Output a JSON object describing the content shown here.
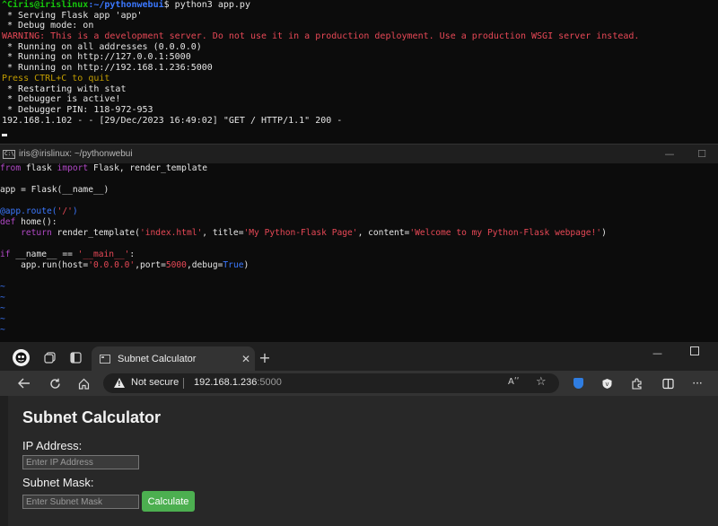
{
  "terminal_top": {
    "prompt_user": "^Ciris@irislinux",
    "prompt_path": ":~/pythonwebui",
    "prompt_symbol": "$",
    "prompt_command": " python3 app.py",
    "lines": [
      {
        "text": " * Serving Flask app 'app'",
        "color": "default"
      },
      {
        "text": " * Debug mode: on",
        "color": "default"
      },
      {
        "text": "WARNING: This is a development server. Do not use it in a production deployment. Use a production WSGI server instead.",
        "color": "red"
      },
      {
        "text": " * Running on all addresses (0.0.0.0)",
        "color": "default"
      },
      {
        "text": " * Running on http://127.0.0.1:5000",
        "color": "default"
      },
      {
        "text": " * Running on http://192.168.1.236:5000",
        "color": "default"
      },
      {
        "text": "Press CTRL+C to quit",
        "color": "yellow"
      },
      {
        "text": " * Restarting with stat",
        "color": "default"
      },
      {
        "text": " * Debugger is active!",
        "color": "default"
      },
      {
        "text": " * Debugger PIN: 118-972-953",
        "color": "default"
      },
      {
        "text": "192.168.1.102 - - [29/Dec/2023 16:49:02] \"GET / HTTP/1.1\" 200 -",
        "color": "default"
      }
    ]
  },
  "terminal_bottom": {
    "window_title": "iris@irislinux: ~/pythonwebui",
    "icon_text": "C:\\",
    "minimize_glyph": "—",
    "maximize_glyph": "☐",
    "code": {
      "l1_kw1": "from",
      "l1_a": " flask ",
      "l1_kw2": "import",
      "l1_b": " Flask, render_template",
      "l3": "app = Flask(__name__)",
      "l5_dec": "@app.route(",
      "l5_str": "'/'",
      "l5_end": ")",
      "l6_kw": "def",
      "l6_rest": " home():",
      "l7_indent": "    ",
      "l7_kw": "return",
      "l7_a": " render_template(",
      "l7_s1": "'index.html'",
      "l7_b": ", title=",
      "l7_s2": "'My Python-Flask Page'",
      "l7_c": ", content=",
      "l7_s3": "'Welcome to my Python-Flask webpage!'",
      "l7_d": ")",
      "l9_kw": "if",
      "l9_a": " __name__ == ",
      "l9_str": "'__main__'",
      "l9_b": ":",
      "l10_a": "    app.run(host=",
      "l10_s": "'0.0.0.0'",
      "l10_b": ",port=",
      "l10_n": "5000",
      "l10_c": ",debug=",
      "l10_t": "True",
      "l10_d": ")",
      "tilde": "~"
    }
  },
  "browser": {
    "tab_title": "Subnet Calculator",
    "tab_close": "✕",
    "new_tab": "+",
    "minimize": "—",
    "security_label": "Not secure",
    "url_host": "192.168.1.236",
    "url_port": ":5000",
    "read_aloud": "Aʹʹ",
    "more_glyph": "···",
    "page": {
      "heading": "Subnet Calculator",
      "ip_label": "IP Address:",
      "ip_placeholder": "Enter IP Address",
      "mask_label": "Subnet Mask:",
      "mask_placeholder": "Enter Subnet Mask",
      "calculate_label": "Calculate"
    },
    "colors": {
      "button": "#4caf50",
      "page_bg": "#282828"
    }
  }
}
